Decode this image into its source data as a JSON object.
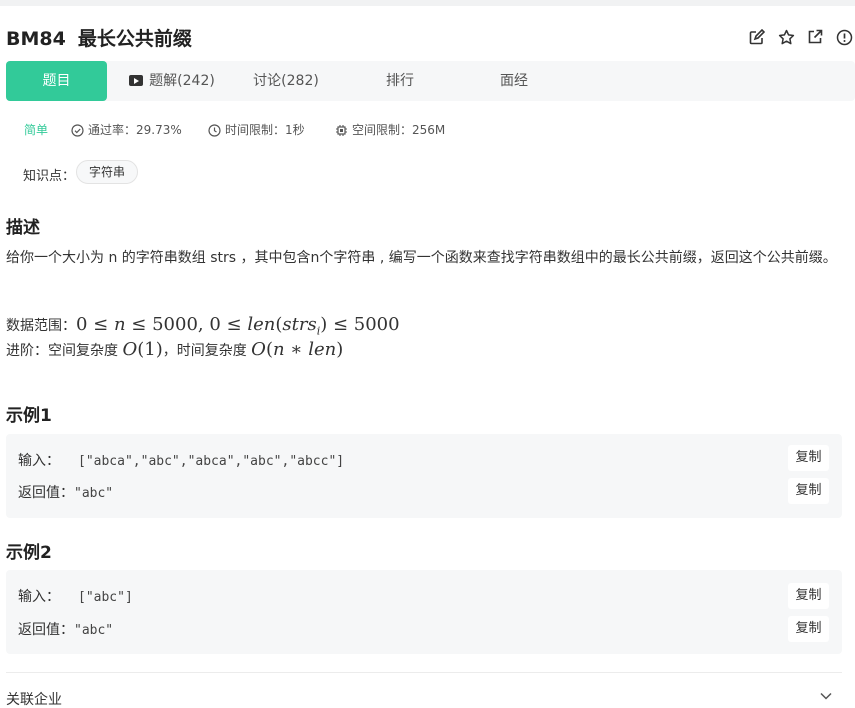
{
  "problem": {
    "id": "BM84",
    "title": "最长公共前缀"
  },
  "title_icons": [
    "edit-icon",
    "star-icon",
    "external-link-icon",
    "info-icon"
  ],
  "tabs": {
    "question": "题目",
    "solutions": "题解(242)",
    "discussion": "讨论(282)",
    "ranking": "排行",
    "interview": "面经"
  },
  "meta": {
    "difficulty": "简单",
    "pass_rate": "通过率：29.73%",
    "time_limit": "时间限制：1秒",
    "space_limit": "空间限制：256M"
  },
  "knowledge": {
    "label": "知识点：",
    "tags": [
      "字符串"
    ]
  },
  "description": {
    "heading": "描述",
    "text": "给你一个大小为 n 的字符串数组 strs ，其中包含n个字符串 , 编写一个函数来查找字符串数组中的最长公共前缀，返回这个公共前缀。",
    "range_label": "数据范围：",
    "advanced_label": "进阶：空间复杂度",
    "advanced_mid": "，时间复杂度"
  },
  "examples": [
    {
      "heading": "示例1",
      "input_label": "输入：",
      "input": "[\"abca\",\"abc\",\"abca\",\"abc\",\"abcc\"]",
      "output_label": "返回值：",
      "output": "\"abc\""
    },
    {
      "heading": "示例2",
      "input_label": "输入：",
      "input": "[\"abc\"]",
      "output_label": "返回值：",
      "output": "\"abc\""
    }
  ],
  "copy_label": "复制",
  "related": {
    "label": "关联企业"
  },
  "colors": {
    "accent": "#32ca99",
    "panel": "#f6f7f8"
  }
}
